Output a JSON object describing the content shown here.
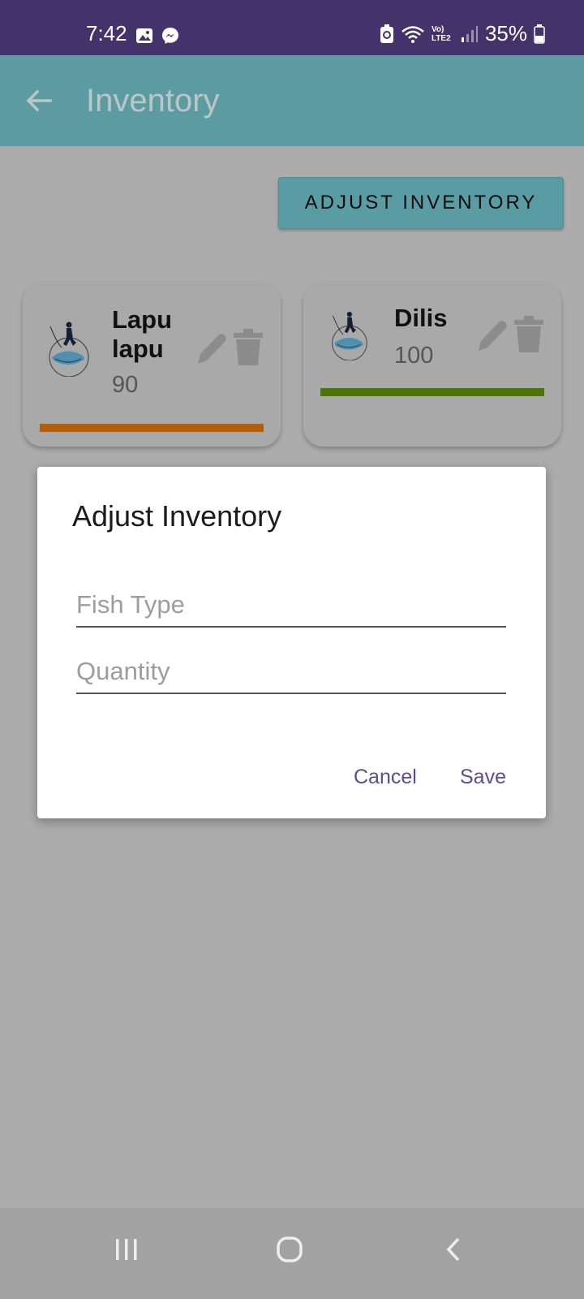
{
  "status_bar": {
    "time": "7:42",
    "battery": "35%",
    "network": "Vo) LTE2",
    "icons": [
      "gallery-icon",
      "messenger-icon",
      "battery-saver-icon",
      "wifi-icon",
      "signal-icon",
      "battery-icon"
    ]
  },
  "app_bar": {
    "title": "Inventory",
    "back_icon": "arrow-left-icon"
  },
  "toolbar": {
    "adjust_label": "ADJUST INVENTORY"
  },
  "items": [
    {
      "name_line1": "Lapu",
      "name_line2": "lapu",
      "quantity": "90",
      "level_color": "#b45e0a",
      "icons": [
        "pencil-icon",
        "trash-icon"
      ]
    },
    {
      "name": "Dilis",
      "quantity": "100",
      "level_color": "#4c7406",
      "icons": [
        "pencil-icon",
        "trash-icon"
      ]
    }
  ],
  "dialog": {
    "title": "Adjust Inventory",
    "fish_type": {
      "value": "",
      "placeholder": "Fish Type"
    },
    "quantity": {
      "value": "",
      "placeholder": "Quantity"
    },
    "cancel_label": "Cancel",
    "save_label": "Save"
  },
  "nav_bar": {
    "icons": [
      "recent-apps-icon",
      "home-icon",
      "back-icon"
    ]
  }
}
